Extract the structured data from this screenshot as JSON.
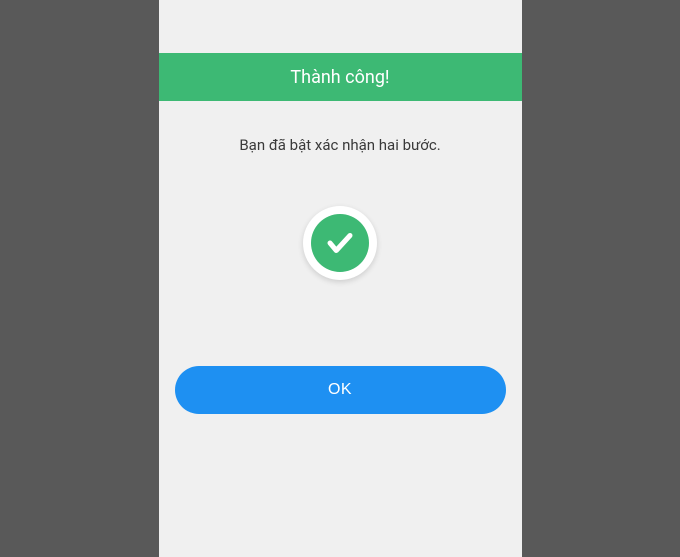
{
  "header": {
    "title": "Thành công!"
  },
  "main": {
    "message": "Bạn đã bật xác nhận hai bước.",
    "icon": "checkmark-success"
  },
  "actions": {
    "ok_label": "OK"
  },
  "colors": {
    "success_green": "#3db974",
    "primary_blue": "#1e90f2",
    "background_gray": "#f0f0f0",
    "frame_gray": "#595959"
  }
}
